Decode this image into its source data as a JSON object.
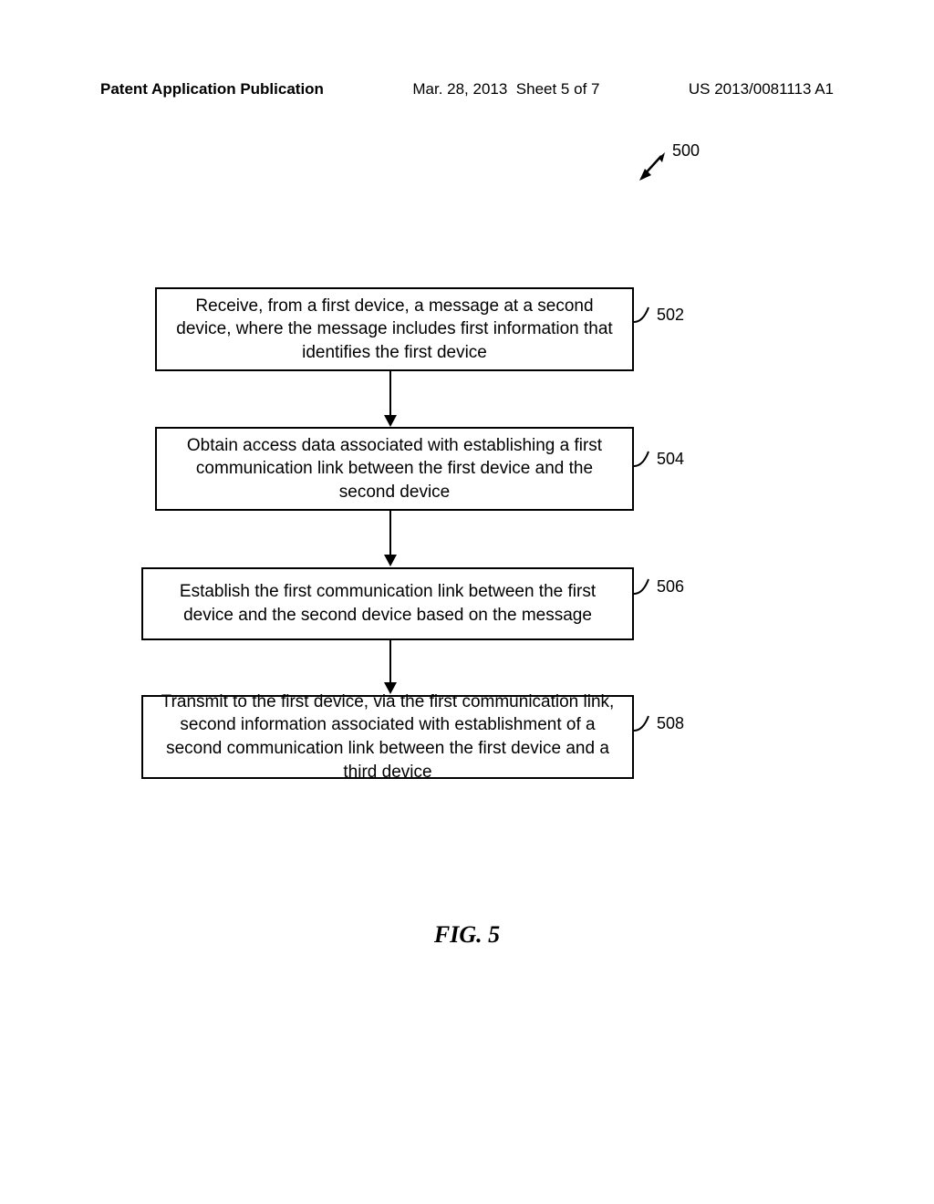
{
  "header": {
    "publication": "Patent Application Publication",
    "date": "Mar. 28, 2013",
    "sheet": "Sheet 5 of 7",
    "number": "US 2013/0081113 A1"
  },
  "diagram": {
    "ref_overall": "500",
    "steps": [
      {
        "ref": "502",
        "text": "Receive, from a first device, a message at a second device, where the message includes first information that identifies the first device"
      },
      {
        "ref": "504",
        "text": "Obtain access data associated with establishing a first communication link between the first device and the second device"
      },
      {
        "ref": "506",
        "text": "Establish the first communication link between the first device and the second device based on the message"
      },
      {
        "ref": "508",
        "text": "Transmit to the first device, via the first communication link, second information associated with establishment of a second communication link between the first device and a third device"
      }
    ],
    "figure_label": "FIG. 5"
  }
}
